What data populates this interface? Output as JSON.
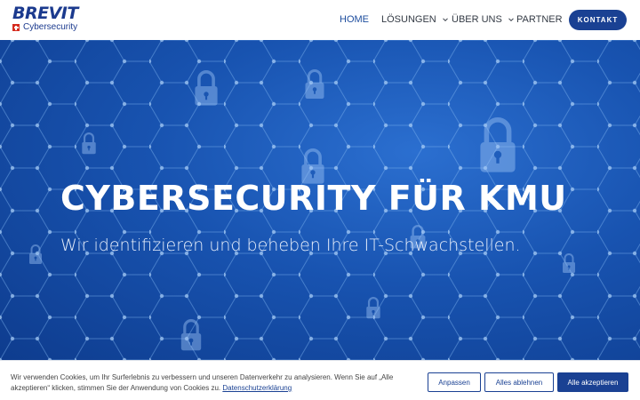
{
  "header": {
    "logo_text": "BREVIT",
    "logo_subtext": "Cybersecurity",
    "nav": [
      {
        "label": "HOME",
        "active": true
      },
      {
        "label": "LÖSUNGEN",
        "dropdown": true
      },
      {
        "label": "ÜBER UNS",
        "dropdown": true
      },
      {
        "label": "PARTNER"
      }
    ],
    "cta_label": "KONTAKT"
  },
  "hero": {
    "title": "CYBERSECURITY FÜR KMU",
    "subtitle": "Wir identifizieren und beheben Ihre IT-Schwachstellen."
  },
  "cookie_banner": {
    "text": "Wir verwenden Cookies, um Ihr Surferlebnis zu verbessern und unseren Datenverkehr zu analysieren. Wenn Sie auf „Alle akzeptieren“ klicken, stimmen Sie der Anwendung von Cookies zu.",
    "link_label": "Datenschutzerklärung",
    "buttons": {
      "customize": "Anpassen",
      "reject": "Alles ablehnen",
      "accept": "Alle akzeptieren"
    }
  },
  "colors": {
    "brand": "#1a4193",
    "hero_bg": "#1853b0",
    "swiss_red": "#d52b1e"
  },
  "icons": [
    "swiss-flag-icon",
    "chevron-down-icon",
    "padlock-icon"
  ]
}
